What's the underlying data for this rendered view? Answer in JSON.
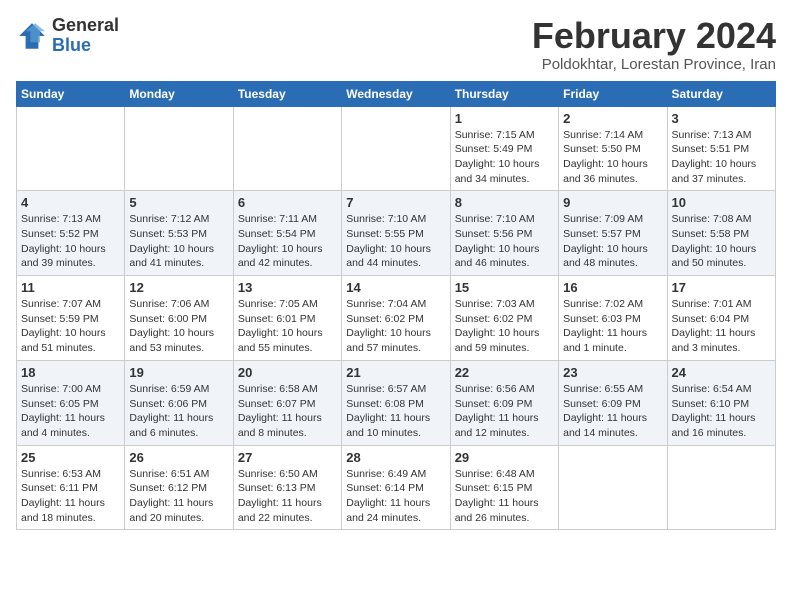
{
  "header": {
    "logo_general": "General",
    "logo_blue": "Blue",
    "main_title": "February 2024",
    "subtitle": "Poldokhtar, Lorestan Province, Iran"
  },
  "calendar": {
    "days_of_week": [
      "Sunday",
      "Monday",
      "Tuesday",
      "Wednesday",
      "Thursday",
      "Friday",
      "Saturday"
    ],
    "weeks": [
      [
        {
          "day": "",
          "info": ""
        },
        {
          "day": "",
          "info": ""
        },
        {
          "day": "",
          "info": ""
        },
        {
          "day": "",
          "info": ""
        },
        {
          "day": "1",
          "info": "Sunrise: 7:15 AM\nSunset: 5:49 PM\nDaylight: 10 hours\nand 34 minutes."
        },
        {
          "day": "2",
          "info": "Sunrise: 7:14 AM\nSunset: 5:50 PM\nDaylight: 10 hours\nand 36 minutes."
        },
        {
          "day": "3",
          "info": "Sunrise: 7:13 AM\nSunset: 5:51 PM\nDaylight: 10 hours\nand 37 minutes."
        }
      ],
      [
        {
          "day": "4",
          "info": "Sunrise: 7:13 AM\nSunset: 5:52 PM\nDaylight: 10 hours\nand 39 minutes."
        },
        {
          "day": "5",
          "info": "Sunrise: 7:12 AM\nSunset: 5:53 PM\nDaylight: 10 hours\nand 41 minutes."
        },
        {
          "day": "6",
          "info": "Sunrise: 7:11 AM\nSunset: 5:54 PM\nDaylight: 10 hours\nand 42 minutes."
        },
        {
          "day": "7",
          "info": "Sunrise: 7:10 AM\nSunset: 5:55 PM\nDaylight: 10 hours\nand 44 minutes."
        },
        {
          "day": "8",
          "info": "Sunrise: 7:10 AM\nSunset: 5:56 PM\nDaylight: 10 hours\nand 46 minutes."
        },
        {
          "day": "9",
          "info": "Sunrise: 7:09 AM\nSunset: 5:57 PM\nDaylight: 10 hours\nand 48 minutes."
        },
        {
          "day": "10",
          "info": "Sunrise: 7:08 AM\nSunset: 5:58 PM\nDaylight: 10 hours\nand 50 minutes."
        }
      ],
      [
        {
          "day": "11",
          "info": "Sunrise: 7:07 AM\nSunset: 5:59 PM\nDaylight: 10 hours\nand 51 minutes."
        },
        {
          "day": "12",
          "info": "Sunrise: 7:06 AM\nSunset: 6:00 PM\nDaylight: 10 hours\nand 53 minutes."
        },
        {
          "day": "13",
          "info": "Sunrise: 7:05 AM\nSunset: 6:01 PM\nDaylight: 10 hours\nand 55 minutes."
        },
        {
          "day": "14",
          "info": "Sunrise: 7:04 AM\nSunset: 6:02 PM\nDaylight: 10 hours\nand 57 minutes."
        },
        {
          "day": "15",
          "info": "Sunrise: 7:03 AM\nSunset: 6:02 PM\nDaylight: 10 hours\nand 59 minutes."
        },
        {
          "day": "16",
          "info": "Sunrise: 7:02 AM\nSunset: 6:03 PM\nDaylight: 11 hours\nand 1 minute."
        },
        {
          "day": "17",
          "info": "Sunrise: 7:01 AM\nSunset: 6:04 PM\nDaylight: 11 hours\nand 3 minutes."
        }
      ],
      [
        {
          "day": "18",
          "info": "Sunrise: 7:00 AM\nSunset: 6:05 PM\nDaylight: 11 hours\nand 4 minutes."
        },
        {
          "day": "19",
          "info": "Sunrise: 6:59 AM\nSunset: 6:06 PM\nDaylight: 11 hours\nand 6 minutes."
        },
        {
          "day": "20",
          "info": "Sunrise: 6:58 AM\nSunset: 6:07 PM\nDaylight: 11 hours\nand 8 minutes."
        },
        {
          "day": "21",
          "info": "Sunrise: 6:57 AM\nSunset: 6:08 PM\nDaylight: 11 hours\nand 10 minutes."
        },
        {
          "day": "22",
          "info": "Sunrise: 6:56 AM\nSunset: 6:09 PM\nDaylight: 11 hours\nand 12 minutes."
        },
        {
          "day": "23",
          "info": "Sunrise: 6:55 AM\nSunset: 6:09 PM\nDaylight: 11 hours\nand 14 minutes."
        },
        {
          "day": "24",
          "info": "Sunrise: 6:54 AM\nSunset: 6:10 PM\nDaylight: 11 hours\nand 16 minutes."
        }
      ],
      [
        {
          "day": "25",
          "info": "Sunrise: 6:53 AM\nSunset: 6:11 PM\nDaylight: 11 hours\nand 18 minutes."
        },
        {
          "day": "26",
          "info": "Sunrise: 6:51 AM\nSunset: 6:12 PM\nDaylight: 11 hours\nand 20 minutes."
        },
        {
          "day": "27",
          "info": "Sunrise: 6:50 AM\nSunset: 6:13 PM\nDaylight: 11 hours\nand 22 minutes."
        },
        {
          "day": "28",
          "info": "Sunrise: 6:49 AM\nSunset: 6:14 PM\nDaylight: 11 hours\nand 24 minutes."
        },
        {
          "day": "29",
          "info": "Sunrise: 6:48 AM\nSunset: 6:15 PM\nDaylight: 11 hours\nand 26 minutes."
        },
        {
          "day": "",
          "info": ""
        },
        {
          "day": "",
          "info": ""
        }
      ]
    ]
  }
}
